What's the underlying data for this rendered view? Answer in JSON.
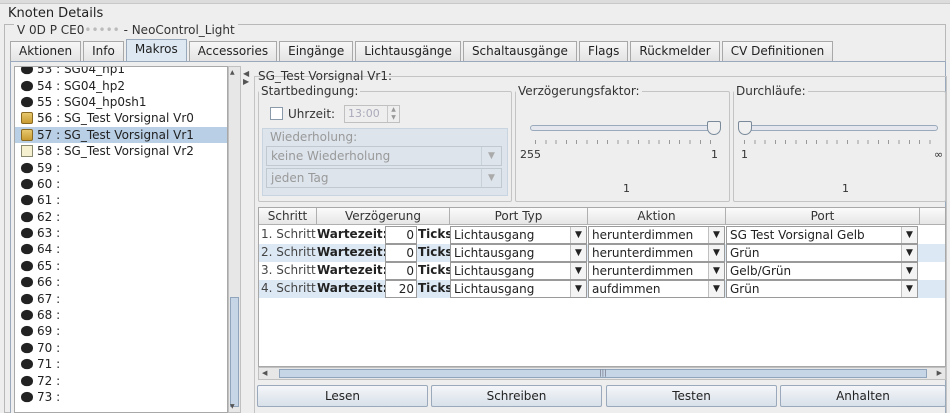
{
  "window": {
    "title": "Knoten Details",
    "node_label": "V 0D P CE0",
    "node_label_hidden": "•••••",
    "node_suffix": " - NeoControl_Light"
  },
  "tabs": [
    "Aktionen",
    "Info",
    "Makros",
    "Accessories",
    "Eingänge",
    "Lichtausgänge",
    "Schaltausgänge",
    "Flags",
    "Rückmelder",
    "CV Definitionen"
  ],
  "active_tab": "Makros",
  "macros": [
    {
      "label": "53 : SG04_hp1",
      "icon": "diamond-icon"
    },
    {
      "label": "54 : SG04_hp2",
      "icon": "diamond-icon"
    },
    {
      "label": "55 : SG04_hp0sh1",
      "icon": "diamond-icon"
    },
    {
      "label": "56 : SG_Test Vorsignal Vr0",
      "icon": "lock-icon"
    },
    {
      "label": "57 : SG_Test Vorsignal Vr1",
      "icon": "lock-icon",
      "selected": true
    },
    {
      "label": "58 : SG_Test Vorsignal Vr2",
      "icon": "note-icon"
    },
    {
      "label": "59 :",
      "icon": "diamond-icon"
    },
    {
      "label": "60 :",
      "icon": "diamond-icon"
    },
    {
      "label": "61 :",
      "icon": "diamond-icon"
    },
    {
      "label": "62 :",
      "icon": "diamond-icon"
    },
    {
      "label": "63 :",
      "icon": "diamond-icon"
    },
    {
      "label": "64 :",
      "icon": "diamond-icon"
    },
    {
      "label": "65 :",
      "icon": "diamond-icon"
    },
    {
      "label": "66 :",
      "icon": "diamond-icon"
    },
    {
      "label": "67 :",
      "icon": "diamond-icon"
    },
    {
      "label": "68 :",
      "icon": "diamond-icon"
    },
    {
      "label": "69 :",
      "icon": "diamond-icon"
    },
    {
      "label": "70 :",
      "icon": "diamond-icon"
    },
    {
      "label": "71 :",
      "icon": "diamond-icon"
    },
    {
      "label": "72 :",
      "icon": "diamond-icon"
    },
    {
      "label": "73 :",
      "icon": "diamond-icon"
    }
  ],
  "macro_title": "SG_Test Vorsignal Vr1:",
  "start": {
    "legend": "Startbedingung:",
    "uhrzeit_label": "Uhrzeit:",
    "uhrzeit_value": "13:00",
    "wiederholung_legend": "Wiederholung:",
    "wiederholung_value": "keine Wiederholung",
    "tag_value": "jeden Tag"
  },
  "delay": {
    "legend": "Verzögerungsfaktor:",
    "min_label": "255",
    "max_label": "1",
    "value": "1"
  },
  "runs": {
    "legend": "Durchläufe:",
    "min_label": "1",
    "max_label": "∞",
    "value": "1"
  },
  "table": {
    "headers": [
      "Schritt",
      "Verzögerung",
      "Port Typ",
      "Aktion",
      "Port"
    ],
    "rows": [
      {
        "step": "1. Schritt",
        "wait": "Wartezeit:",
        "delay": "0",
        "unit": "Ticks",
        "port_type": "Lichtausgang",
        "action": "herunterdimmen",
        "port": "SG Test Vorsignal Gelb"
      },
      {
        "step": "2. Schritt",
        "wait": "Wartezeit:",
        "delay": "0",
        "unit": "Ticks",
        "port_type": "Lichtausgang",
        "action": "herunterdimmen",
        "port": "Grün"
      },
      {
        "step": "3. Schritt",
        "wait": "Wartezeit:",
        "delay": "0",
        "unit": "Ticks",
        "port_type": "Lichtausgang",
        "action": "herunterdimmen",
        "port": "Gelb/Grün"
      },
      {
        "step": "4. Schritt",
        "wait": "Wartezeit:",
        "delay": "20",
        "unit": "Ticks",
        "port_type": "Lichtausgang",
        "action": "aufdimmen",
        "port": "Grün"
      }
    ]
  },
  "buttons": {
    "read": "Lesen",
    "write": "Schreiben",
    "test": "Testen",
    "stop": "Anhalten"
  }
}
